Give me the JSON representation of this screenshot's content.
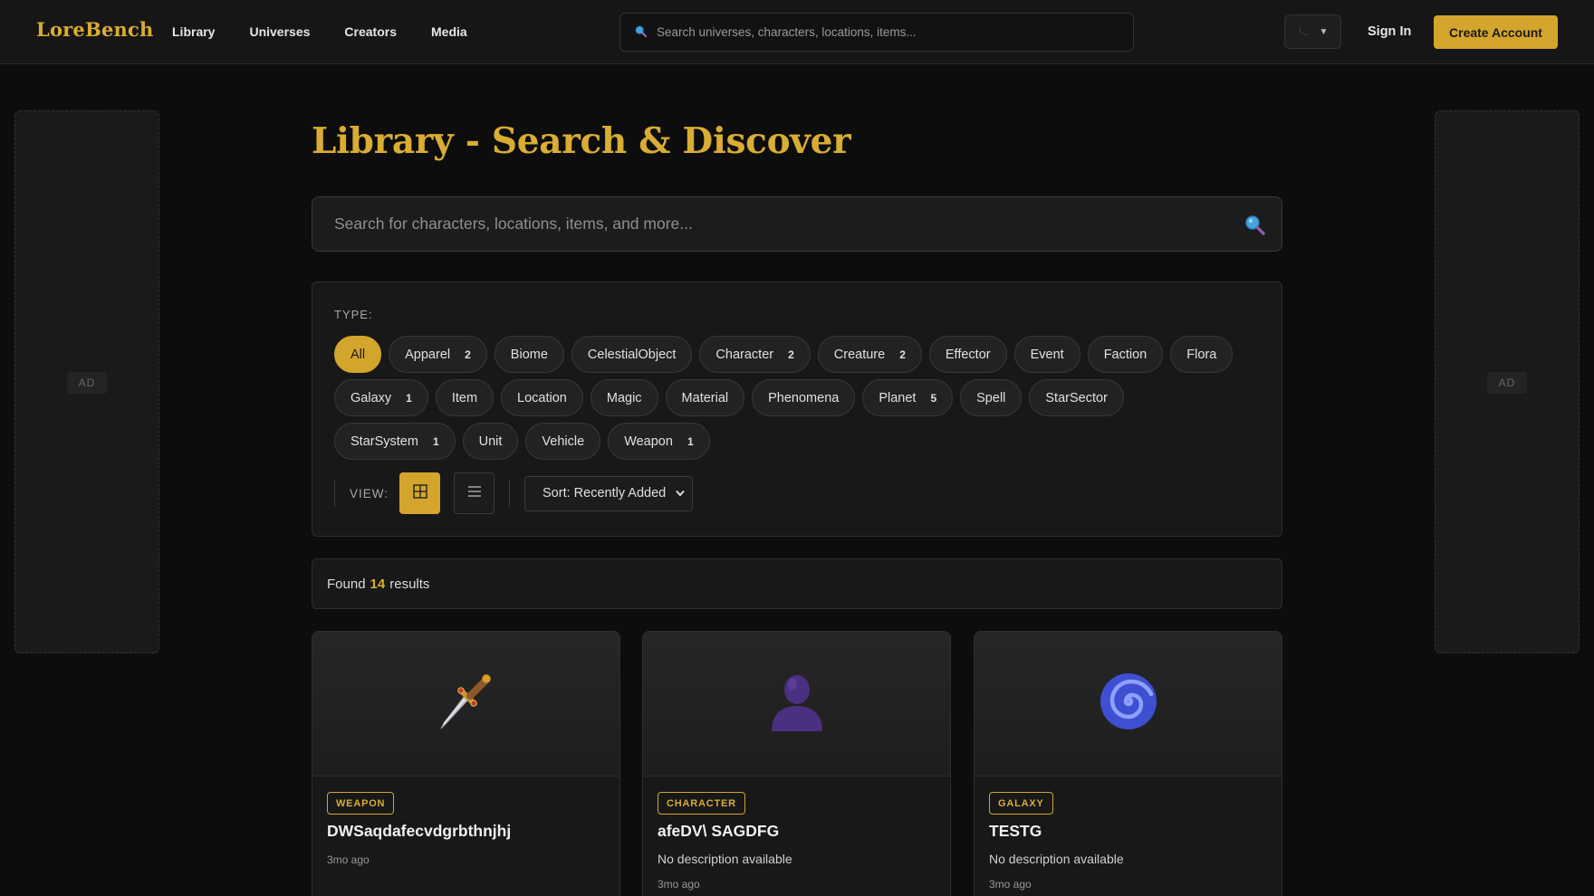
{
  "header": {
    "logo": "LoreBench",
    "nav": [
      "Library",
      "Universes",
      "Creators",
      "Media"
    ],
    "search_placeholder": "Search universes, characters, locations, items...",
    "theme_icon": "moon-icon",
    "sign_in": "Sign In",
    "create_account": "Create Account"
  },
  "ads": {
    "left": "AD",
    "right": "AD"
  },
  "page": {
    "title": "Library - Search & Discover",
    "search_placeholder": "Search for characters, locations, items, and more..."
  },
  "filters": {
    "type_label": "TYPE:",
    "types": [
      {
        "label": "All",
        "count": "",
        "active": true
      },
      {
        "label": "Apparel",
        "count": "2"
      },
      {
        "label": "Biome",
        "count": ""
      },
      {
        "label": "CelestialObject",
        "count": ""
      },
      {
        "label": "Character",
        "count": "2"
      },
      {
        "label": "Creature",
        "count": "2"
      },
      {
        "label": "Effector",
        "count": ""
      },
      {
        "label": "Event",
        "count": ""
      },
      {
        "label": "Faction",
        "count": ""
      },
      {
        "label": "Flora",
        "count": ""
      },
      {
        "label": "Galaxy",
        "count": "1"
      },
      {
        "label": "Item",
        "count": ""
      },
      {
        "label": "Location",
        "count": ""
      },
      {
        "label": "Magic",
        "count": ""
      },
      {
        "label": "Material",
        "count": ""
      },
      {
        "label": "Phenomena",
        "count": ""
      },
      {
        "label": "Planet",
        "count": "5"
      },
      {
        "label": "Spell",
        "count": ""
      },
      {
        "label": "StarSector",
        "count": ""
      },
      {
        "label": "StarSystem",
        "count": "1"
      },
      {
        "label": "Unit",
        "count": ""
      },
      {
        "label": "Vehicle",
        "count": ""
      },
      {
        "label": "Weapon",
        "count": "1"
      }
    ],
    "view_label": "VIEW:",
    "view_modes": [
      "grid-icon",
      "list-icon"
    ],
    "active_view": "grid",
    "sort_label": "Sort: Recently Added"
  },
  "results": {
    "prefix": "Found",
    "count": "14",
    "suffix": "results"
  },
  "cards": [
    {
      "type": "WEAPON",
      "name": "DWSaqdafecvdgrbthnjhj",
      "description": "",
      "time": "3mo ago",
      "icon": "dagger-icon"
    },
    {
      "type": "CHARACTER",
      "name": "afeDV\\ SAGDFG",
      "description": "No description available",
      "time": "3mo ago",
      "icon": "person-silhouette-icon"
    },
    {
      "type": "GALAXY",
      "name": "TESTG",
      "description": "No description available",
      "time": "3mo ago",
      "icon": "spiral-galaxy-icon"
    }
  ],
  "colors": {
    "accent": "#d4a52c",
    "background": "#0d0d0d",
    "panel": "#181818"
  }
}
